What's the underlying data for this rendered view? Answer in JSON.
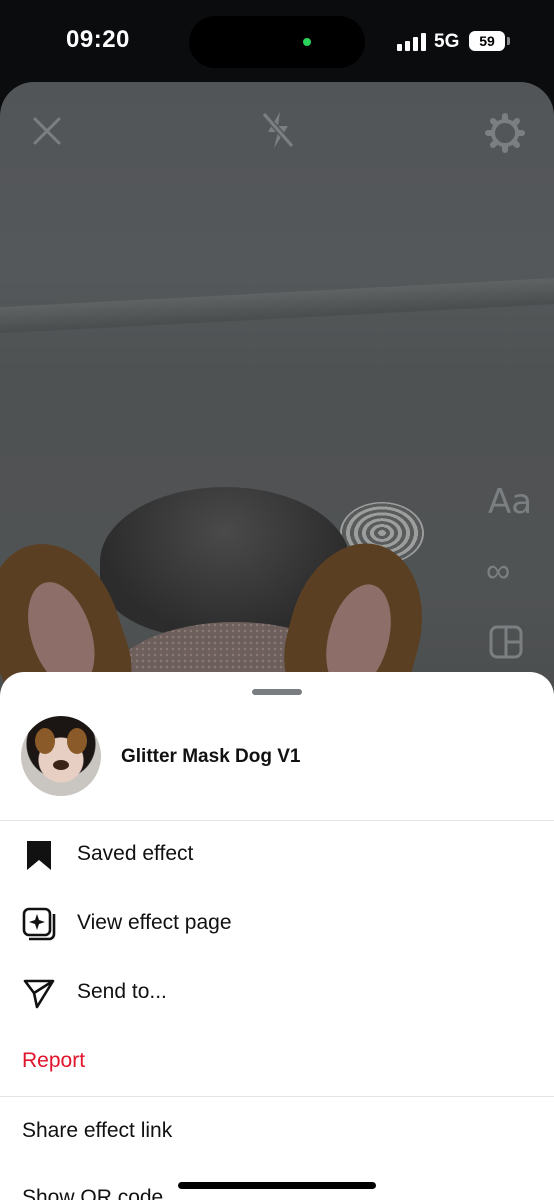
{
  "status_bar": {
    "time": "09:20",
    "network": "5G",
    "battery": "59"
  },
  "camera": {
    "icons": {
      "close": "close-icon",
      "flash": "flash-off-icon",
      "settings": "gear-icon",
      "text": "Aa",
      "infinity": "∞",
      "layout": "layout-icon"
    }
  },
  "sheet": {
    "effect_name": "Glitter Mask Dog V1",
    "items": [
      {
        "label": "Saved effect",
        "icon": "bookmark-icon"
      },
      {
        "label": "View effect page",
        "icon": "effect-sparkle-icon"
      },
      {
        "label": "Send to...",
        "icon": "send-icon"
      }
    ],
    "report_label": "Report",
    "share_link_label": "Share effect link",
    "qr_label": "Show QR code"
  },
  "colors": {
    "report": "#e0142b",
    "status_dot": "#2bd35a"
  }
}
